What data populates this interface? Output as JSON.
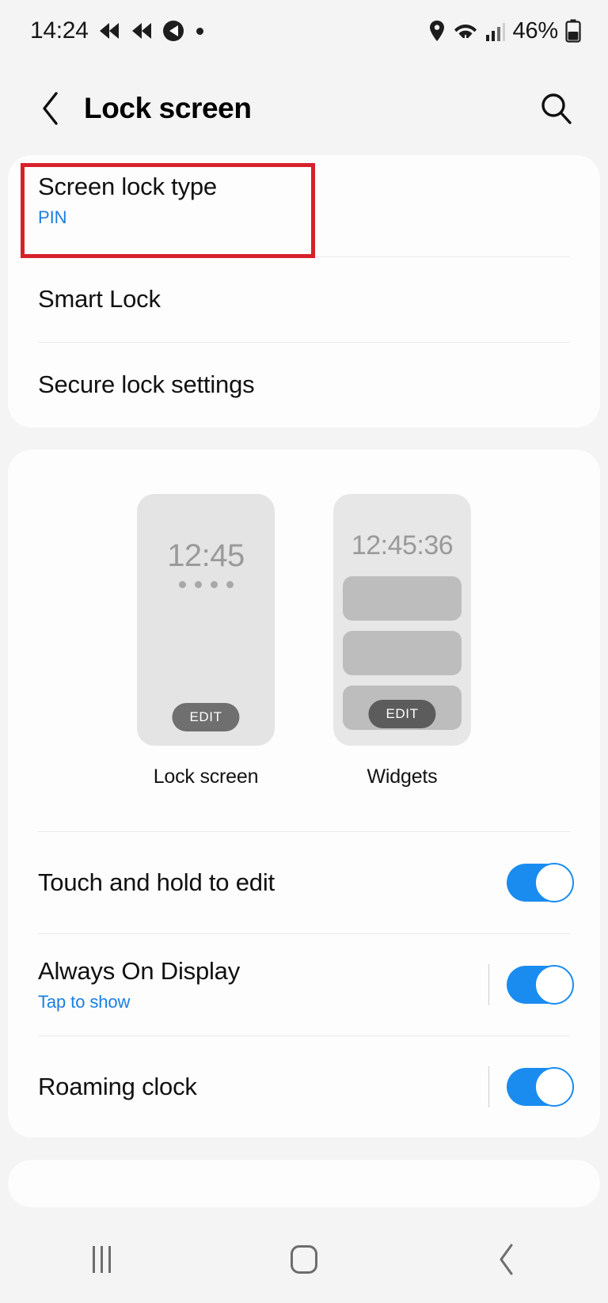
{
  "status_bar": {
    "time": "14:24",
    "left_icons": [
      "rewind-arrow-icon",
      "rewind-arrow-icon",
      "dark-circle-app-icon",
      "dot-indicator-icon"
    ],
    "right_icons": [
      "location-pin-icon",
      "wifi-icon",
      "signal-bars-icon"
    ],
    "battery_percent": "46%",
    "battery_icon": "battery-icon"
  },
  "header": {
    "back_icon": "back-chevron-icon",
    "title": "Lock screen",
    "search_icon": "search-icon"
  },
  "lock_card": {
    "screen_lock_type": {
      "title": "Screen lock type",
      "value": "PIN",
      "highlighted": true,
      "highlight_color": "#d8202a"
    },
    "smart_lock": {
      "title": "Smart Lock"
    },
    "secure_lock_settings": {
      "title": "Secure lock settings"
    }
  },
  "preview_card": {
    "previews": [
      {
        "label": "Lock screen",
        "clock": "12:45",
        "pin_dots": 4,
        "edit_label": "EDIT"
      },
      {
        "label": "Widgets",
        "clock": "12:45:36",
        "widget_bars": 3,
        "edit_label": "EDIT"
      }
    ],
    "toggles": [
      {
        "title": "Touch and hold to edit",
        "subtitle": "",
        "state": "on",
        "has_separator": false
      },
      {
        "title": "Always On Display",
        "subtitle": "Tap to show",
        "state": "on",
        "has_separator": true
      },
      {
        "title": "Roaming clock",
        "subtitle": "",
        "state": "on",
        "has_separator": true
      }
    ]
  },
  "nav_bar": {
    "recents_icon": "recents-icon",
    "home_icon": "home-icon",
    "back_icon": "back-chevron-icon"
  },
  "colors": {
    "accent_blue": "#1a8cf0",
    "link_blue": "#1b7fe0",
    "highlight_red": "#d8202a"
  }
}
